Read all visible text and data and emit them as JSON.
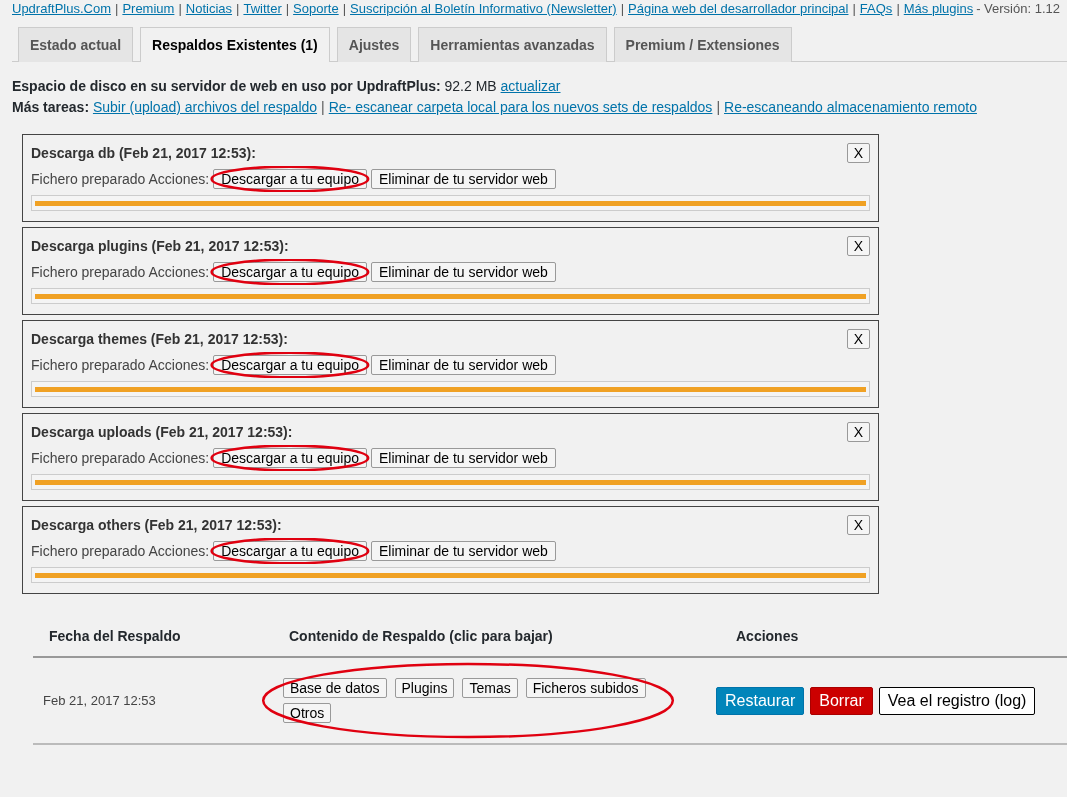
{
  "top_links": [
    "UpdraftPlus.Com",
    "Premium",
    "Noticias",
    "Twitter",
    "Soporte",
    "Suscripción al Boletín Informativo (Newsletter)",
    "Página web del desarrollador principal",
    "FAQs",
    "Más plugins"
  ],
  "separator": "|",
  "version": "- Versión: 1.12",
  "tabs": [
    {
      "label": "Estado actual",
      "selected": false
    },
    {
      "label": "Respaldos Existentes (1)",
      "selected": true
    },
    {
      "label": "Ajustes",
      "selected": false
    },
    {
      "label": "Herramientas avanzadas",
      "selected": false
    },
    {
      "label": "Premium / Extensiones",
      "selected": false
    }
  ],
  "disk_usage": {
    "label": "Espacio de disco en su servidor de web en uso por UpdraftPlus:",
    "value": "92.2 MB",
    "link": "actualizar"
  },
  "more_tasks": {
    "label": "Más tareas:",
    "links": [
      "Subir (upload) archivos del respaldo",
      "Re- escanear carpeta local para los nuevos sets de respaldos",
      "Re-escaneando almacenamiento remoto"
    ]
  },
  "downloads": [
    {
      "title": "Descarga db (Feb 21, 2017 12:53):",
      "status": "Fichero preparado Acciones:",
      "download": "Descargar a tu equipo",
      "delete": "Eliminar de tu servidor web",
      "close": "X",
      "level": 1,
      "circled": true
    },
    {
      "title": "Descarga plugins (Feb 21, 2017 12:53):",
      "status": "Fichero preparado Acciones:",
      "download": "Descargar a tu equipo",
      "delete": "Eliminar de tu servidor web",
      "close": "X",
      "level": 1,
      "circled": true
    },
    {
      "title": "Descarga themes (Feb 21, 2017 12:53):",
      "status": "Fichero preparado Acciones:",
      "download": "Descargar a tu equipo",
      "delete": "Eliminar de tu servidor web",
      "close": "X",
      "level": 1,
      "circled": true
    },
    {
      "title": "Descarga uploads (Feb 21, 2017 12:53):",
      "status": "Fichero preparado Acciones:",
      "download": "Descargar a tu equipo",
      "delete": "Eliminar de tu servidor web",
      "close": "X",
      "level": 1,
      "circled": true
    },
    {
      "title": "Descarga others (Feb 21, 2017 12:53):",
      "status": "Fichero preparado Acciones:",
      "download": "Descargar a tu equipo",
      "delete": "Eliminar de tu servidor web",
      "close": "X",
      "level": 1,
      "circled": true
    }
  ],
  "table": {
    "columns": [
      "Fecha del Respaldo",
      "Contenido de Respaldo (clic para bajar)",
      "Acciones"
    ],
    "rows": [
      {
        "date": "Feb 21, 2017 12:53",
        "contents": [
          "Base de datos",
          "Plugins",
          "Temas",
          "Ficheros subidos",
          "Otros"
        ],
        "contents_circled": true,
        "actions": [
          {
            "kind": "primary",
            "label": "Restaurar"
          },
          {
            "kind": "danger",
            "label": "Borrar"
          },
          {
            "kind": "outline",
            "label": "Vea el registro (log)"
          }
        ]
      }
    ]
  }
}
